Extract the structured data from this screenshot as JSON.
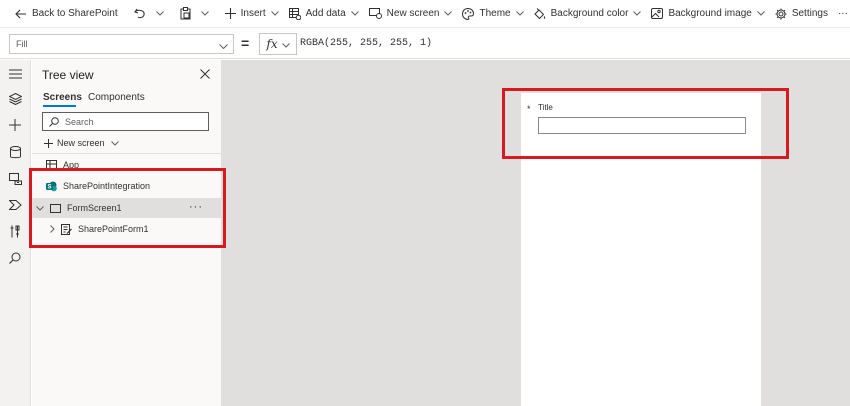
{
  "command_bar": {
    "back_label": "Back to SharePoint",
    "insert_label": "Insert",
    "add_data_label": "Add data",
    "new_screen_label": "New screen",
    "theme_label": "Theme",
    "background_color_label": "Background color",
    "background_image_label": "Background image",
    "settings_label": "Settings",
    "more_label": "···"
  },
  "formula_bar": {
    "property": "Fill",
    "equals": "=",
    "fx_label": "fx",
    "formula": "RGBA(255, 255, 255, 1)"
  },
  "rail": {
    "icons": [
      "hamburger-icon",
      "layers-icon",
      "plus-icon",
      "database-icon",
      "media-icon",
      "variables-icon",
      "tools-icon",
      "search-icon"
    ]
  },
  "tree_view": {
    "title": "Tree view",
    "tabs": [
      {
        "label": "Screens",
        "active": true
      },
      {
        "label": "Components",
        "active": false
      }
    ],
    "search_placeholder": "Search",
    "new_screen_label": "New screen",
    "nodes": [
      {
        "label": "App",
        "icon": "app-icon"
      },
      {
        "label": "SharePointIntegration",
        "icon": "sharepoint-icon"
      },
      {
        "label": "FormScreen1",
        "icon": "screen-icon",
        "selected": true,
        "expanded": true
      },
      {
        "label": "SharePointForm1",
        "icon": "form-icon"
      }
    ],
    "node_more": "···"
  },
  "canvas": {
    "field_required_marker": "*",
    "field_label": "Title",
    "field_value": ""
  },
  "colors": {
    "accent": "#0078d4",
    "highlight": "#d71920",
    "canvas_bg": "#e1dfdd",
    "sharepoint": "#036c70"
  }
}
